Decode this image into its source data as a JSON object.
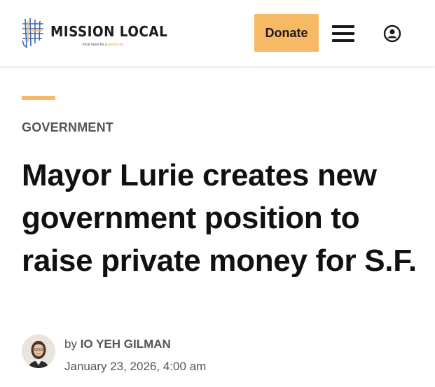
{
  "header": {
    "logo_text": "MISSION LOCAL",
    "logo_tagline_prefix": "local news for a",
    "logo_tagline_accent": "global city",
    "donate_label": "Donate",
    "menu_icon": "hamburger-menu-icon",
    "account_icon": "user-account-icon"
  },
  "article": {
    "category": "GOVERNMENT",
    "headline": "Mayor Lurie creates new government position to raise private money for S.F.",
    "byline_prefix": "by",
    "author": "IO YEH GILMAN",
    "date": "January 23, 2026, 4:00 am"
  },
  "colors": {
    "accent": "#f8b965",
    "text_dark": "#111111",
    "text_muted": "#555555",
    "logo_blue": "#3a66b8"
  }
}
